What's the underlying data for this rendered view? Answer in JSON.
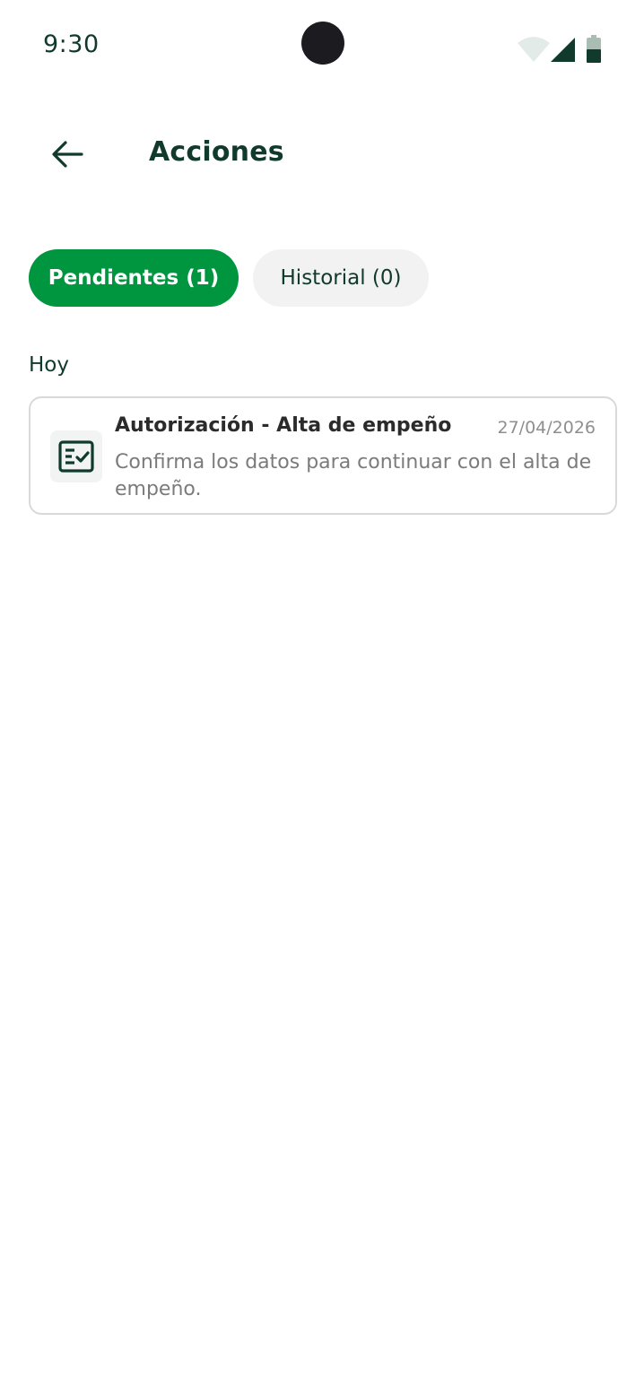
{
  "status_bar": {
    "time": "9:30",
    "icons": [
      "wifi-icon",
      "signal-icon",
      "battery-icon"
    ]
  },
  "header": {
    "back_icon": "arrow-left-icon",
    "title": "Acciones"
  },
  "tabs": [
    {
      "label": "Pendientes (1)",
      "active": true
    },
    {
      "label": "Historial (0)",
      "active": false
    }
  ],
  "section": {
    "label": "Hoy"
  },
  "items": [
    {
      "icon": "checklist-icon",
      "title": "Autorización - Alta de empeño",
      "date": "27/04/2026",
      "description": "Confirma los datos para continuar con el alta de empeño."
    }
  ],
  "colors": {
    "primary_green": "#00963f",
    "dark_green": "#0f3a2c",
    "tab_inactive_bg": "#f2f2f2",
    "card_border": "#d9d9d9",
    "muted_text": "#7b7b7b"
  }
}
